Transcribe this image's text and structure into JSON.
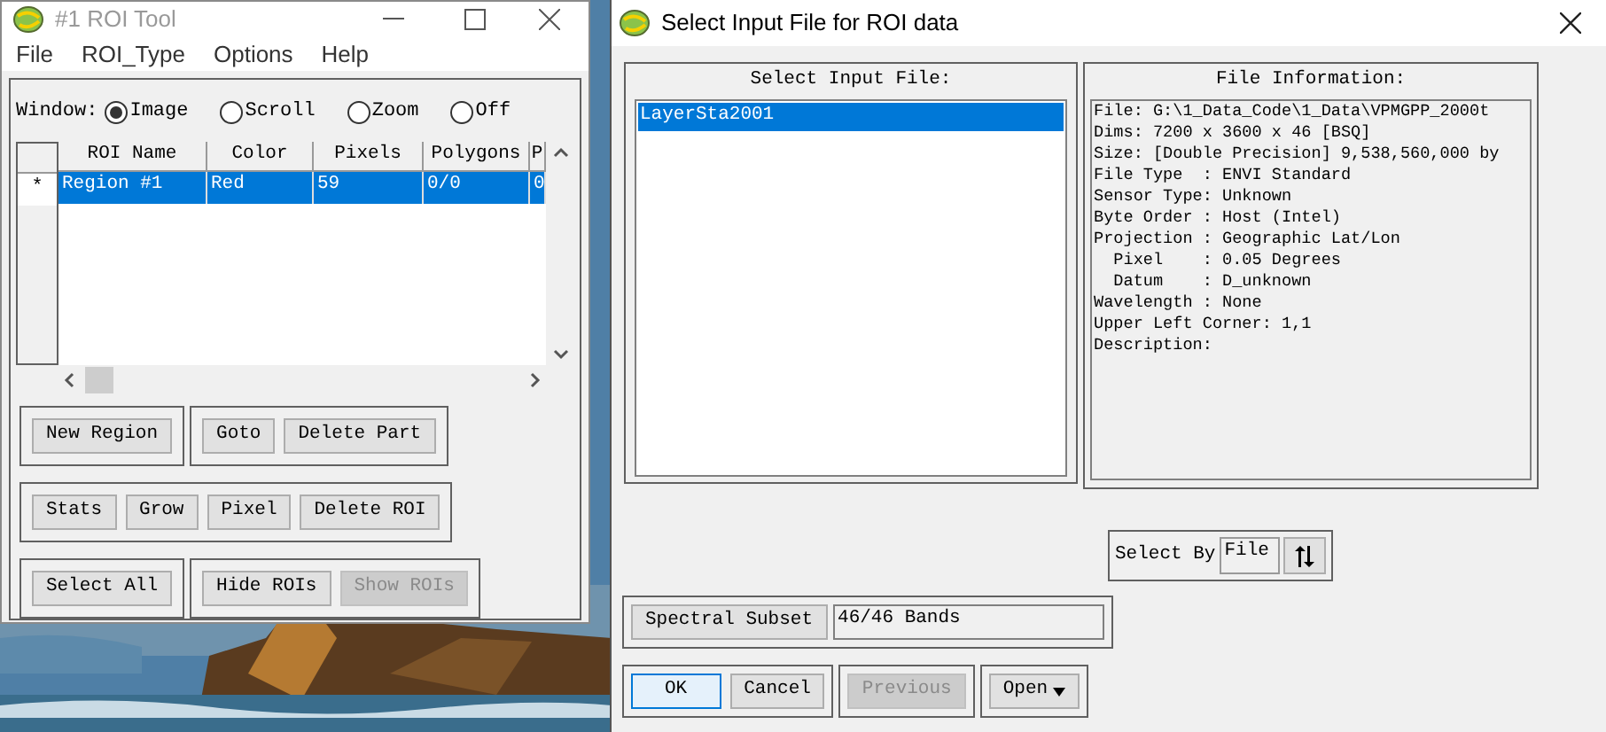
{
  "roi_window": {
    "title": "#1 ROI Tool",
    "menu": [
      "File",
      "ROI_Type",
      "Options",
      "Help"
    ],
    "window_choice": {
      "label": "Window:",
      "options": [
        {
          "label": "Image",
          "selected": true
        },
        {
          "label": "Scroll",
          "selected": false
        },
        {
          "label": "Zoom",
          "selected": false
        },
        {
          "label": "Off",
          "selected": false
        }
      ]
    },
    "table": {
      "columns": [
        "ROI Name",
        "Color",
        "Pixels",
        "Polygons",
        "P"
      ],
      "rows": [
        {
          "marker": "*",
          "cells": [
            "Region #1",
            "Red",
            "59",
            "0/0",
            "0"
          ],
          "selected": true
        }
      ]
    },
    "button_groups": [
      [
        [
          {
            "label": "New Region",
            "disabled": false
          }
        ],
        [
          {
            "label": "Goto",
            "disabled": false
          },
          {
            "label": "Delete Part",
            "disabled": false
          }
        ]
      ],
      [
        [
          {
            "label": "Stats",
            "disabled": false
          },
          {
            "label": "Grow",
            "disabled": false
          },
          {
            "label": "Pixel",
            "disabled": false
          },
          {
            "label": "Delete ROI",
            "disabled": false
          }
        ]
      ],
      [
        [
          {
            "label": "Select All",
            "disabled": false
          }
        ],
        [
          {
            "label": "Hide ROIs",
            "disabled": false
          },
          {
            "label": "Show ROIs",
            "disabled": true
          }
        ]
      ]
    ]
  },
  "dialog": {
    "title": "Select Input File for ROI data",
    "file_list": {
      "title": "Select Input File:",
      "items": [
        {
          "name": "LayerSta2001",
          "selected": true
        }
      ]
    },
    "file_info": {
      "title": "File Information:",
      "lines": [
        "File: G:\\1_Data_Code\\1_Data\\VPMGPP_2000t",
        "Dims: 7200 x 3600 x 46 [BSQ]",
        "Size: [Double Precision] 9,538,560,000 by",
        "File Type  : ENVI Standard",
        "Sensor Type: Unknown",
        "Byte Order : Host (Intel)",
        "Projection : Geographic Lat/Lon",
        "  Pixel    : 0.05 Degrees",
        "  Datum    : D_unknown",
        "Wavelength : None",
        "Upper Left Corner: 1,1",
        "Description:"
      ]
    },
    "select_by": {
      "label": "Select By",
      "value": "File"
    },
    "spectral_subset": {
      "button": "Spectral Subset",
      "value": "46/46 Bands"
    },
    "button_groups": [
      [
        {
          "label": "OK",
          "kind": "default",
          "disabled": false
        },
        {
          "label": "Cancel",
          "kind": "plain",
          "disabled": false
        }
      ],
      [
        {
          "label": "Previous",
          "kind": "plain",
          "disabled": true
        }
      ],
      [
        {
          "label": "Open",
          "kind": "dropdown",
          "disabled": false
        }
      ]
    ]
  }
}
